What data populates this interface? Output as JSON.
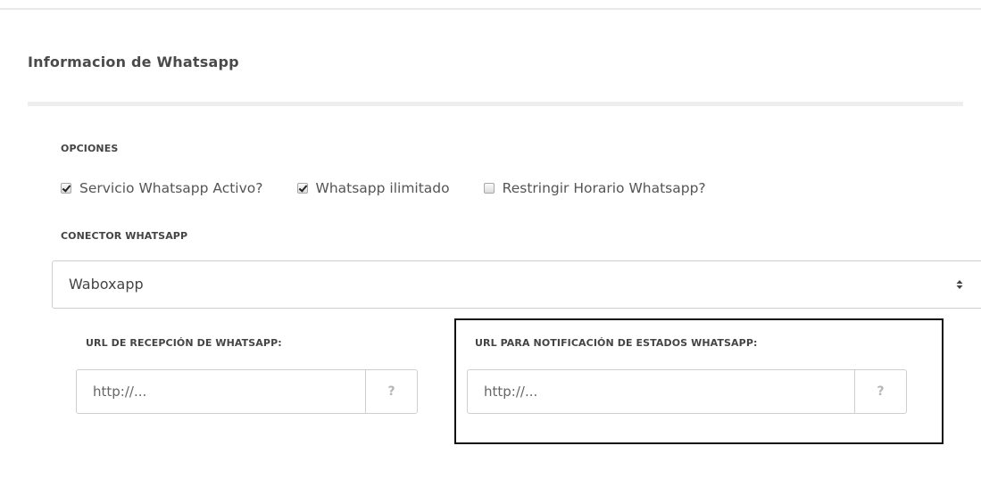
{
  "section": {
    "title": "Informacion de Whatsapp"
  },
  "options": {
    "label": "OPCIONES",
    "checkboxes": [
      {
        "label": "Servicio Whatsapp Activo?",
        "checked": true
      },
      {
        "label": "Whatsapp ilimitado",
        "checked": true
      },
      {
        "label": "Restringir Horario Whatsapp?",
        "checked": false
      }
    ]
  },
  "connector": {
    "label": "CONECTOR WHATSAPP",
    "selected": "Waboxapp",
    "arrow_icon": "select-updown-icon"
  },
  "url_reception": {
    "label": "URL DE RECEPCIÓN DE WHATSAPP:",
    "placeholder": "http://...",
    "help": "?"
  },
  "url_notification": {
    "label": "URL PARA NOTIFICACIÓN DE ESTADOS WHATSAPP:",
    "placeholder": "http://...",
    "help": "?"
  },
  "colors": {
    "text": "#555555",
    "border": "#cfcfcf",
    "highlight_border": "#111111",
    "addon_text": "#b5b5b5"
  }
}
